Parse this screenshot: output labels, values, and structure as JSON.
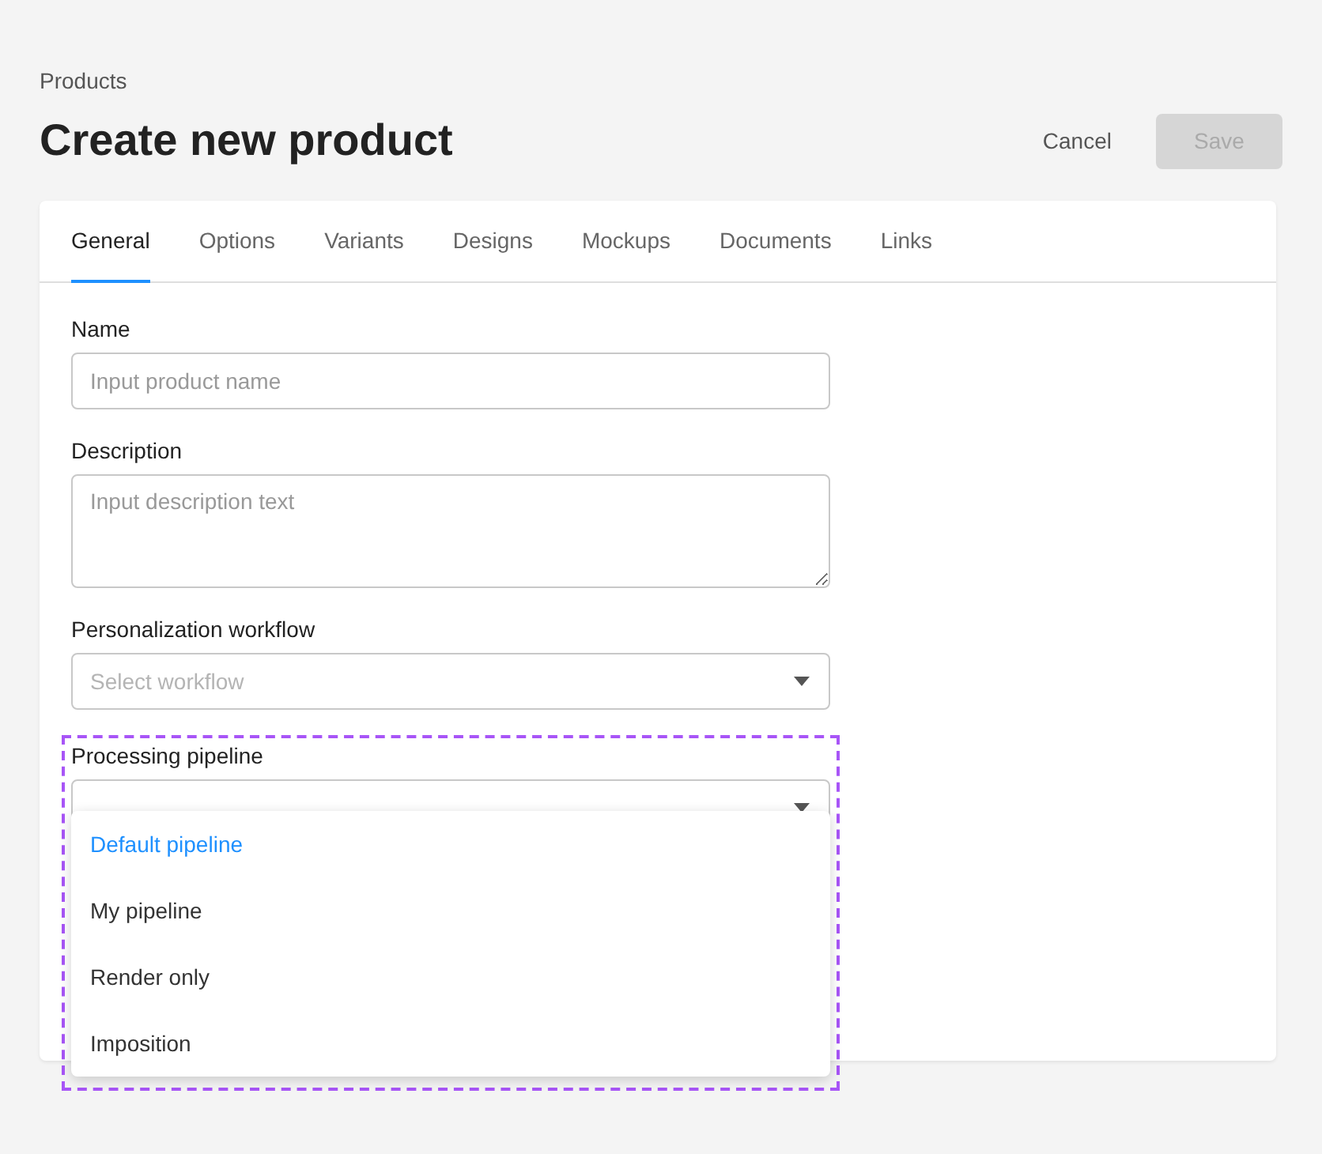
{
  "breadcrumb": "Products",
  "title": "Create new product",
  "actions": [
    {
      "label": "Cancel",
      "kind": "text",
      "disabled": false
    },
    {
      "label": "Save",
      "kind": "filled",
      "disabled": true
    }
  ],
  "tabs": [
    {
      "label": "General",
      "selected": true
    },
    {
      "label": "Options",
      "selected": false
    },
    {
      "label": "Variants",
      "selected": false
    },
    {
      "label": "Designs",
      "selected": false
    },
    {
      "label": "Mockups",
      "selected": false
    },
    {
      "label": "Documents",
      "selected": false
    },
    {
      "label": "Links",
      "selected": false
    }
  ],
  "fields": [
    {
      "label": "Name",
      "kind": "input",
      "placeholder": "Input product name",
      "highlighted": false
    },
    {
      "label": "Description",
      "kind": "textarea",
      "placeholder": "Input description text",
      "highlighted": false
    },
    {
      "label": "Personalization workflow",
      "kind": "select",
      "placeholder": "Select workflow",
      "highlighted": false
    },
    {
      "label": "Processing pipeline",
      "kind": "select",
      "highlighted": true,
      "expanded": true,
      "options": [
        {
          "label": "Default pipeline",
          "selected": true
        },
        {
          "label": "My pipeline",
          "selected": false
        },
        {
          "label": "Render only",
          "selected": false
        },
        {
          "label": "Imposition",
          "selected": false
        }
      ]
    }
  ]
}
